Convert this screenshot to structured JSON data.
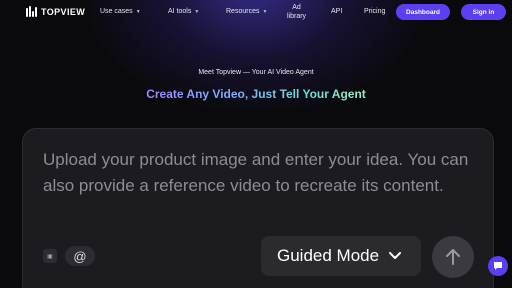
{
  "brand": {
    "name": "TOPVIEW"
  },
  "nav": {
    "items": [
      {
        "label": "Use cases"
      },
      {
        "label": "AI tools"
      },
      {
        "label": "Resources"
      },
      {
        "label_line1": "Ad",
        "label_line2": "library"
      },
      {
        "label": "API"
      },
      {
        "label": "Pricing"
      }
    ],
    "dashboard_label": "Dashboard",
    "signin_label": "Sign in"
  },
  "hero": {
    "subtitle": "Meet Topview — Your AI Video Agent",
    "headline": "Create Any Video, Just Tell Your Agent"
  },
  "composer": {
    "placeholder": "Upload your product image and enter your idea. You can also provide a reference video to recreate its content.",
    "mode_label": "Guided Mode"
  },
  "colors": {
    "accent": "#5b3ff0",
    "panel": "#1c1c20",
    "background": "#0a0a0d"
  }
}
